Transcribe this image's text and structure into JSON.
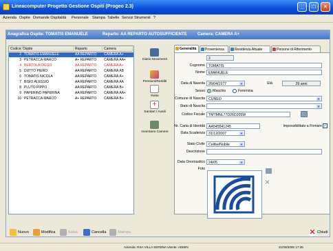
{
  "window": {
    "title": "Lineacomputer Progetto Gestione Ospiti (Progeo 2.3)"
  },
  "menu": [
    "Azienda",
    "Ospite",
    "Domande Ospitalità",
    "Personale",
    "Stampa",
    "Tabelle",
    "Servizi",
    "Strumenti",
    "?"
  ],
  "header": {
    "guest": "Anagrafica Ospite: TOMATIS EMANUELE",
    "department": "Reparto: AA  REPARTO AUTOSUFFICIENTE",
    "room": "Camera: CAMERA A+"
  },
  "list": {
    "columns": [
      "Codice",
      "Ospite",
      "Reparto",
      "Camera"
    ],
    "rows": [
      {
        "code": "2",
        "name": "TOMATIS EMANUELE",
        "dept": "AA  REPARTO",
        "room": "CAMERA A+",
        "state": "selected"
      },
      {
        "code": "3",
        "name": "PETRACCA MARCO",
        "dept": "A+  REPARTO",
        "room": "CAMERA AA+",
        "state": "normal"
      },
      {
        "code": "4",
        "name": "BERTOLA DIEGO",
        "dept": "AA  REPARTO",
        "room": "CAMERA A+",
        "state": "disabled"
      },
      {
        "code": "5",
        "name": "DUTTO PIERO",
        "dept": "AA  REPARTO",
        "room": "CAMERA AB",
        "state": "normal"
      },
      {
        "code": "6",
        "name": "TOMATIS NICOLA",
        "dept": "AA  REPARTO",
        "room": "CAMERA A+",
        "state": "normal"
      },
      {
        "code": "7",
        "name": "BISIO ALESSIO",
        "dept": "AA  REPARTO",
        "room": "CAMERA AA",
        "state": "normal"
      },
      {
        "code": "8",
        "name": "PLUTO PIPPO",
        "dept": "AA  REPARTO",
        "room": "CAMERA B+",
        "state": "normal"
      },
      {
        "code": "9",
        "name": "PAPERINO PAPERINA",
        "dept": "AA  REPARTO",
        "room": "CAMERA AA+",
        "state": "normal"
      },
      {
        "code": "10",
        "name": "PETRACCA MARCO",
        "dept": "A+  REPARTO",
        "room": "CAMERA B+",
        "state": "normal"
      }
    ]
  },
  "sidebar_tools": [
    {
      "label": "Diario Movimenti",
      "icon": "car-icon"
    },
    {
      "label": "Pensioni/Redditi",
      "icon": "money-icon"
    },
    {
      "label": "Rette",
      "icon": "calendar-icon"
    },
    {
      "label": "Sanitari / Ausili",
      "icon": "medical-icon"
    },
    {
      "label": "Inventario Camere",
      "icon": "bed-icon"
    }
  ],
  "tabs": [
    "Generalità",
    "Provenienza",
    "Residenza Attuale",
    "Persone di Riferimento"
  ],
  "form": {
    "codice_label": "Codice",
    "codice": "2",
    "cognome_label": "Cognome",
    "cognome": "TOMATIS",
    "nome_label": "Nome",
    "nome": "EMANUELE",
    "nascita_label": "Data di Nascita",
    "nascita": "26/04/1977",
    "eta_label": "Età",
    "eta": "29 anni",
    "sesso_label": "Sesso",
    "maschio": "Maschio",
    "femmina": "Femmina",
    "comune_label": "Comune di Nascita",
    "comune": "CUNEO",
    "stato_label": "Stato di Nascita",
    "stato": "",
    "cf_label": "Codice Fiscale",
    "cf": "TMTMNL77D26D205W",
    "ci_label": "Nr. Carta di Identità",
    "ci": "AA545541245",
    "impossibilitato_label": "Impossibilitato a Firmare",
    "scadenza_label": "Data Scadenza",
    "scadenza": "31/12/2007",
    "civile_label": "Stato Civile",
    "civile": "Celibe/Nubile",
    "descrizione_label": "Descrizione",
    "descrizione": "",
    "onomastico_label": "Data Onomastico",
    "onomastico": "24/05",
    "foto_label": "Foto"
  },
  "bottom_tools": [
    {
      "label": "Nuovo",
      "enabled": true
    },
    {
      "label": "Modifica",
      "enabled": true
    },
    {
      "label": "Salva",
      "enabled": false
    },
    {
      "label": "Cancella",
      "enabled": true
    },
    {
      "label": "Stampa",
      "enabled": false
    },
    {
      "label": "Chiudi",
      "enabled": true
    }
  ],
  "status": {
    "left": "",
    "center": "Azienda: RSA VILLA SERENA  Utente: ADMIN",
    "right": "21/09/2006  17:35"
  },
  "colors": {
    "title_bar": "#0a4ed8",
    "header_bar": "#4a76c2",
    "selection": "#316ac5"
  }
}
